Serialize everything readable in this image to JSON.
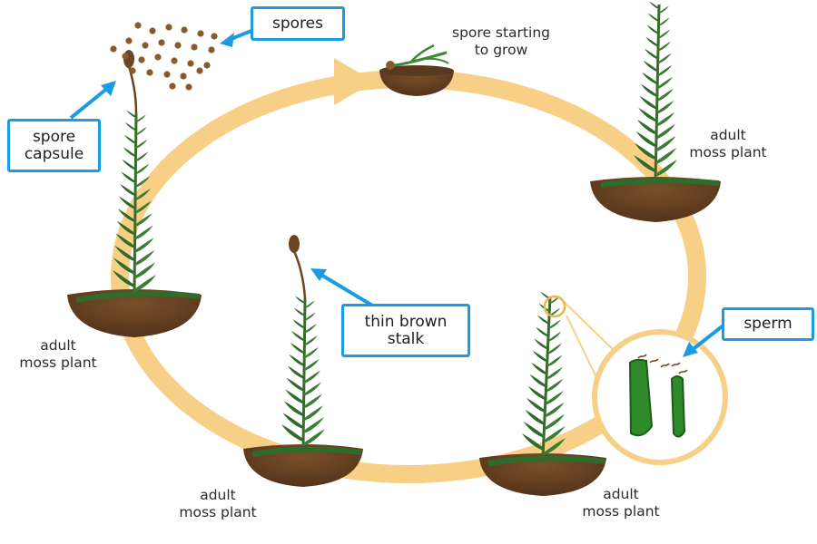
{
  "colors": {
    "cycle": "#f8cf86",
    "callout": "#1c9ce0",
    "soil": "#6b4423",
    "leaf": "#2f6b2a",
    "spore": "#8a5a2b"
  },
  "labels": {
    "spore_starting": "spore starting\nto grow",
    "adult_top_right": "adult\nmoss plant",
    "adult_left": "adult\nmoss plant",
    "adult_bottom_center": "adult\nmoss plant",
    "adult_bottom_right": "adult\nmoss plant"
  },
  "callouts": {
    "spores": "spores",
    "spore_capsule": "spore\ncapsule",
    "thin_brown_stalk": "thin brown\nstalk",
    "sperm": "sperm"
  }
}
